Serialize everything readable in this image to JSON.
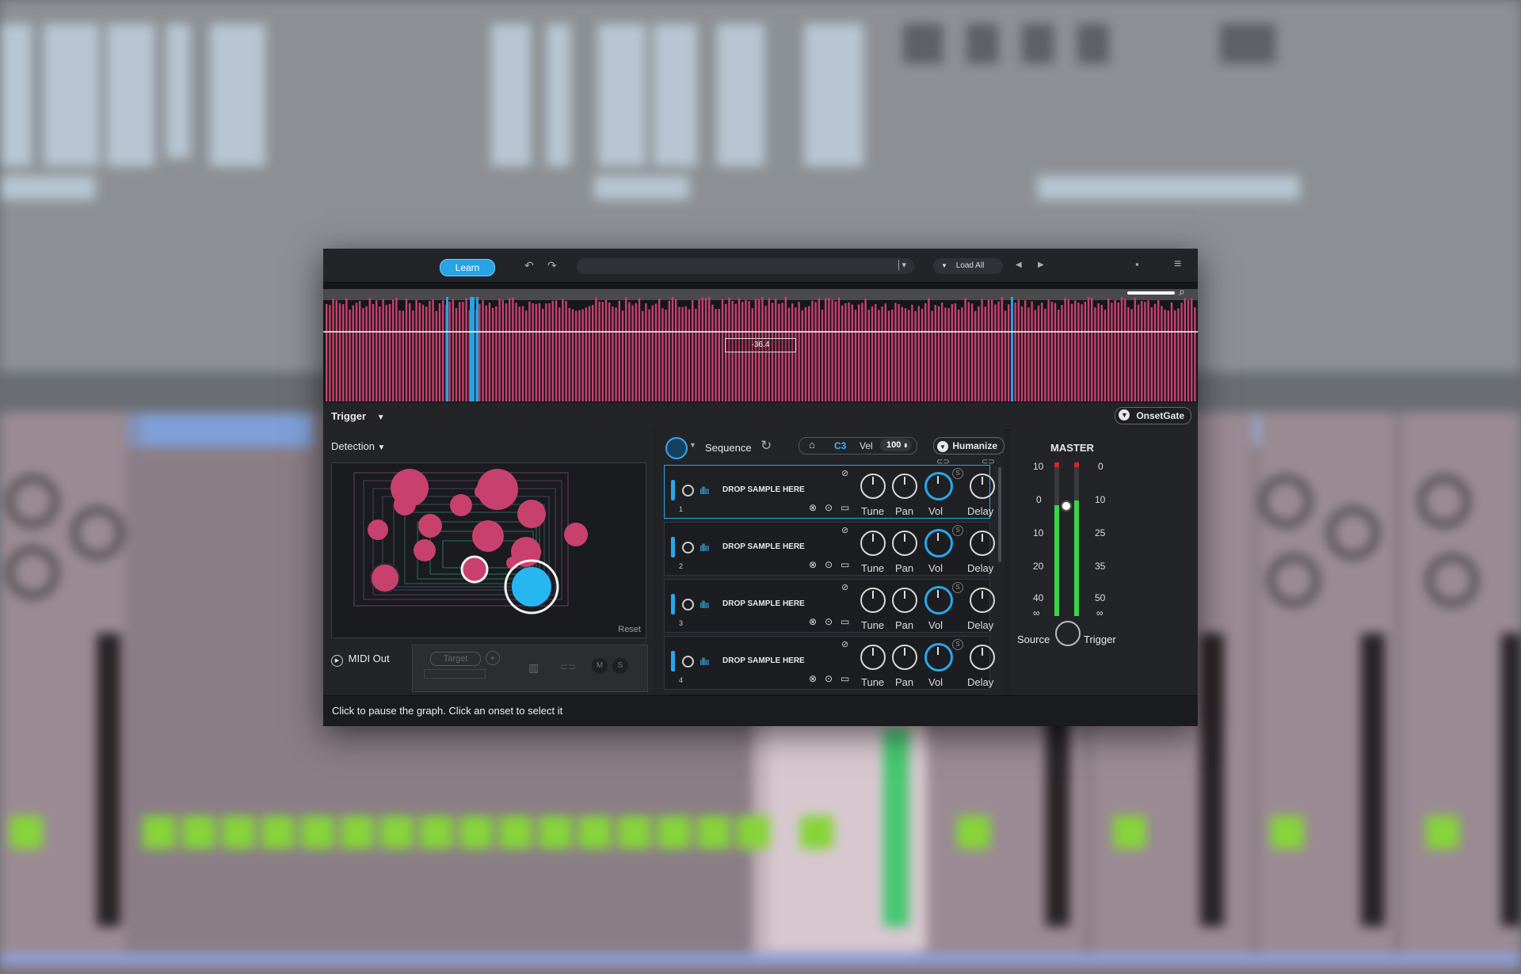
{
  "topbar": {
    "learn_label": "Learn",
    "load_all_label": "Load All",
    "undo_icon": "undo-icon",
    "redo_icon": "redo-icon"
  },
  "waveform": {
    "threshold_value": "-36.4"
  },
  "trigger_bar": {
    "trigger_label": "Trigger",
    "onsetgate_label": "OnsetGate"
  },
  "detection": {
    "label": "Detection",
    "reset_label": "Reset",
    "midi_out_label": "MIDI Out",
    "target_label": "Target",
    "m_label": "M",
    "s_label": "S"
  },
  "sequence": {
    "label": "Sequence",
    "note": "C3",
    "vel_label": "Vel",
    "vel_value": "100",
    "humanize_label": "Humanize"
  },
  "slots": [
    {
      "number": "1",
      "text": "DROP SAMPLE HERE",
      "tune": "Tune",
      "pan": "Pan",
      "vol": "Vol",
      "delay": "Delay",
      "solo": "S"
    },
    {
      "number": "2",
      "text": "DROP SAMPLE HERE",
      "tune": "Tune",
      "pan": "Pan",
      "vol": "Vol",
      "delay": "Delay",
      "solo": "S"
    },
    {
      "number": "3",
      "text": "DROP SAMPLE HERE",
      "tune": "Tune",
      "pan": "Pan",
      "vol": "Vol",
      "delay": "Delay",
      "solo": "S"
    },
    {
      "number": "4",
      "text": "DROP SAMPLE HERE",
      "tune": "Tune",
      "pan": "Pan",
      "vol": "Vol",
      "delay": "Delay",
      "solo": "S"
    }
  ],
  "master": {
    "title": "MASTER",
    "left_scale": [
      "10",
      "0",
      "10",
      "20",
      "40",
      "∞"
    ],
    "right_scale": [
      "0",
      "10",
      "25",
      "35",
      "50",
      "∞"
    ],
    "source_label": "Source",
    "trigger_label": "Trigger"
  },
  "status": {
    "text": "Click to pause the graph. Click an onset to select it"
  },
  "colors": {
    "accent": "#27a3e6",
    "onset": "#c8416e",
    "meter": "#3ad34a"
  }
}
